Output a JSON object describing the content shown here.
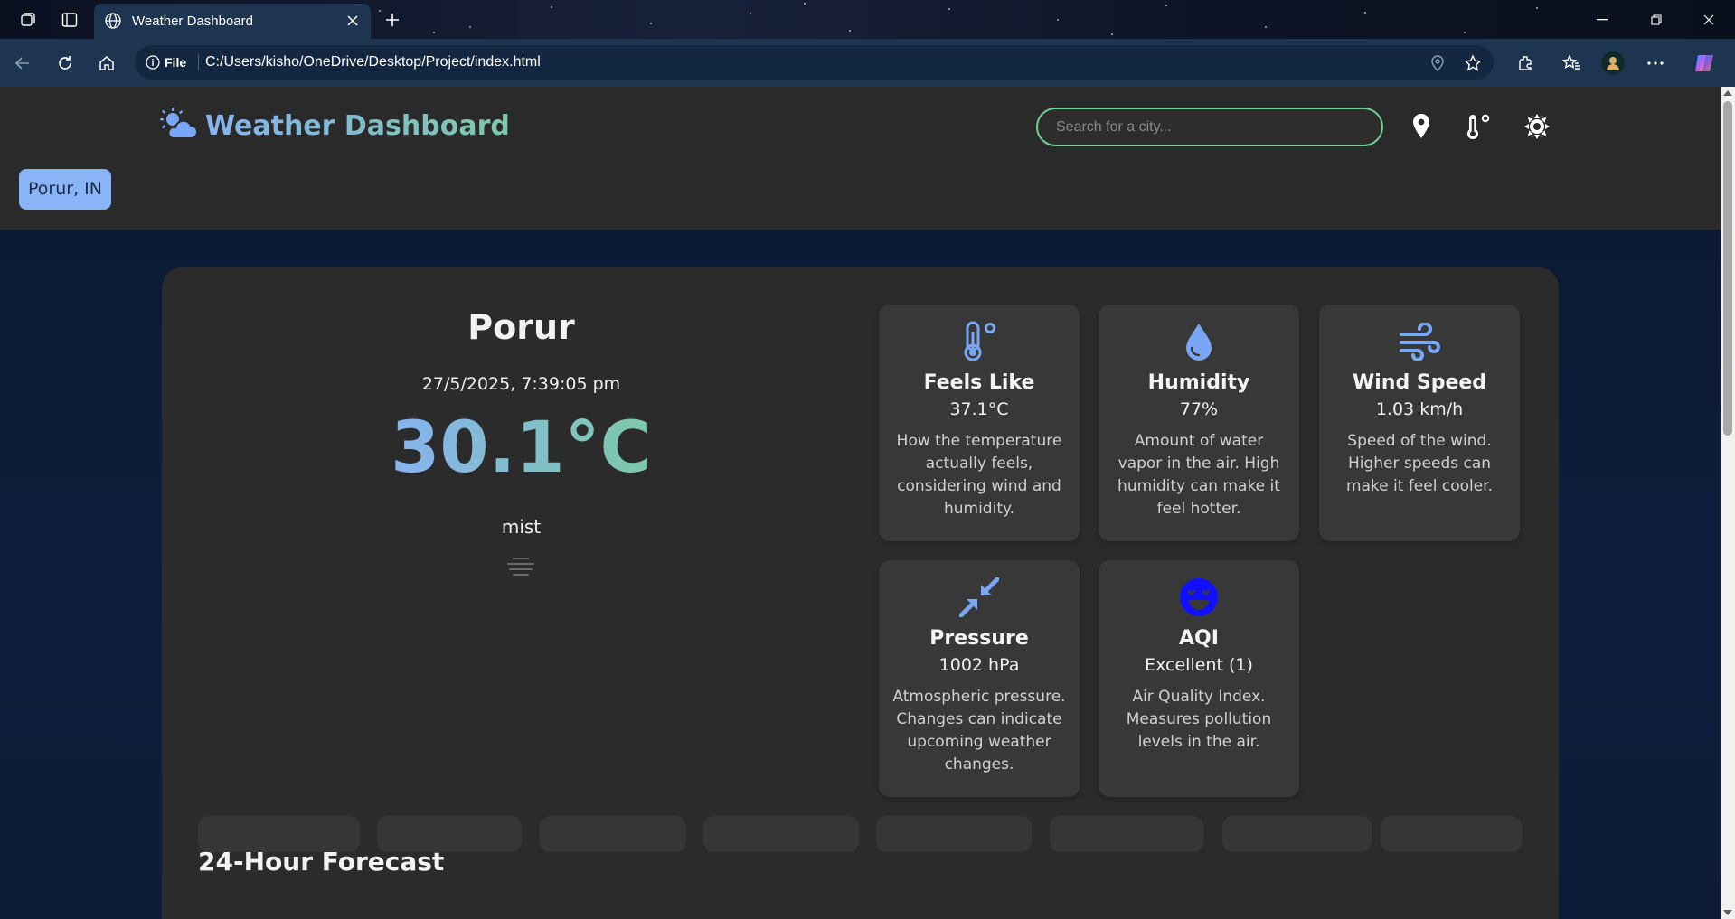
{
  "browser": {
    "tab_title": "Weather Dashboard",
    "url_scheme": "File",
    "url": "C:/Users/kisho/OneDrive/Desktop/Project/index.html"
  },
  "header": {
    "title": "Weather Dashboard",
    "search_placeholder": "Search for a city...",
    "location_chip": "Porur, IN"
  },
  "current": {
    "city": "Porur",
    "datetime": "27/5/2025, 7:39:05 pm",
    "temperature": "30.1°C",
    "condition": "mist"
  },
  "metrics": [
    {
      "icon": "thermometer-icon",
      "title": "Feels Like",
      "value": "37.1°C",
      "desc": "How the temperature actually feels, considering wind and humidity."
    },
    {
      "icon": "droplet-icon",
      "title": "Humidity",
      "value": "77%",
      "desc": "Amount of water vapor in the air. High humidity can make it feel hotter."
    },
    {
      "icon": "wind-icon",
      "title": "Wind Speed",
      "value": "1.03 km/h",
      "desc": "Speed of the wind. Higher speeds can make it feel cooler."
    },
    {
      "icon": "compress-icon",
      "title": "Pressure",
      "value": "1002 hPa",
      "desc": "Atmospheric pressure. Changes can indicate upcoming weather changes."
    },
    {
      "icon": "smile-icon",
      "title": "AQI",
      "value": "Excellent (1)",
      "desc": "Air Quality Index. Measures pollution levels in the air."
    }
  ],
  "forecast": {
    "title": "24-Hour Forecast",
    "cards_visible": 8
  },
  "colors": {
    "accent_blue": "#8ab4f8",
    "accent_green": "#6fcf97",
    "icon_blue": "#7aa7f5",
    "aqi_icon": "#1010ff"
  }
}
